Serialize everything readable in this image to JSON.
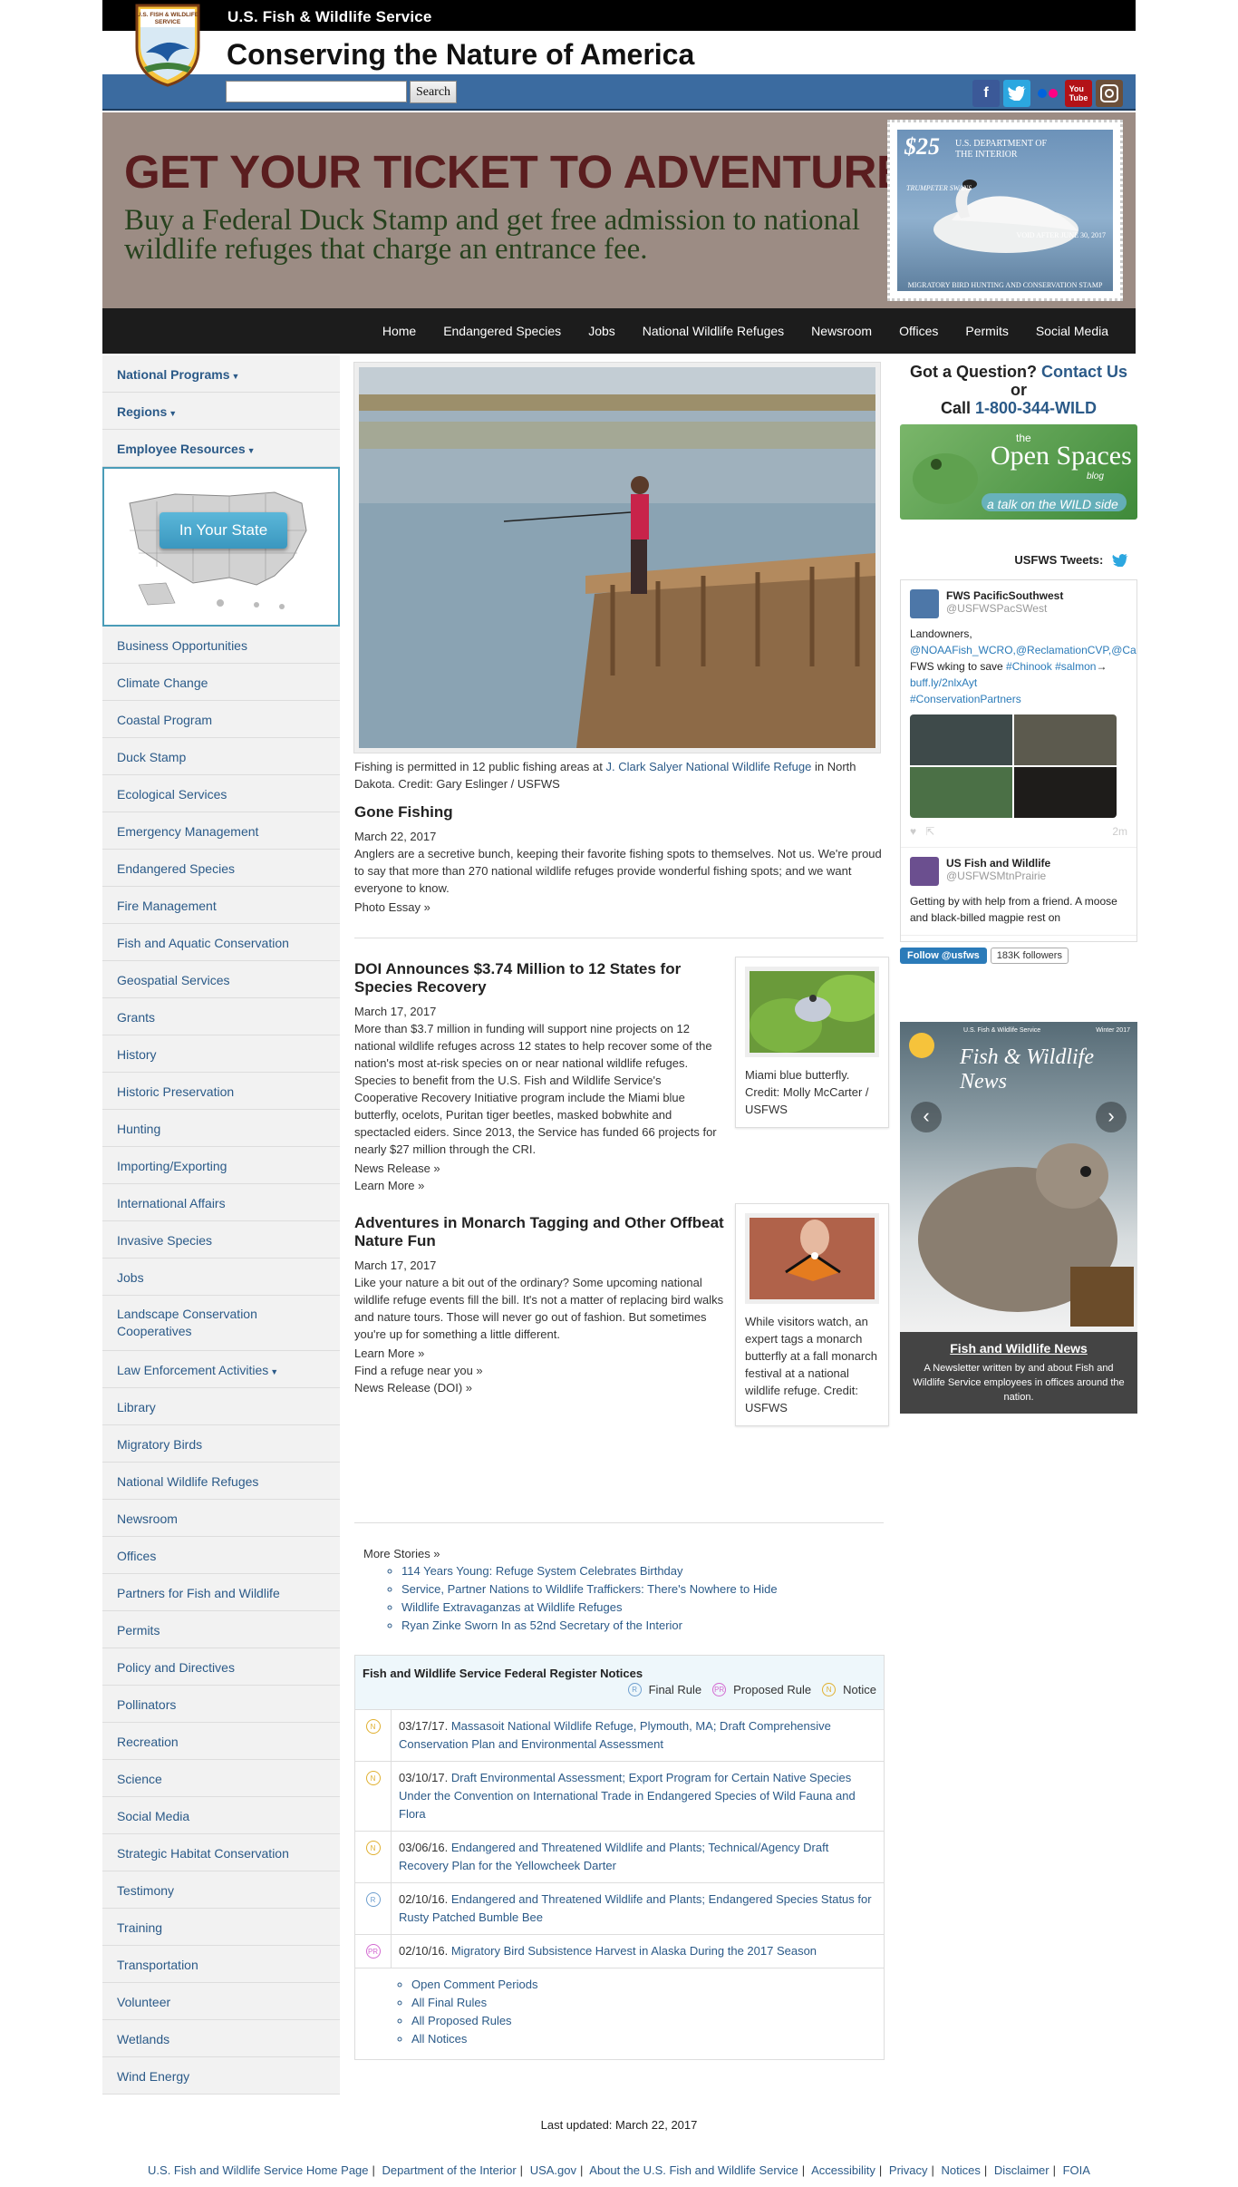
{
  "header": {
    "agency": "U.S. Fish & Wildlife Service",
    "tagline": "Conserving the Nature of America",
    "search_button": "Search",
    "search_placeholder": "",
    "logo_text": "U.S. FISH & WILDLIFE SERVICE",
    "social": [
      "facebook-icon",
      "twitter-icon",
      "flickr-icon",
      "youtube-icon",
      "instagram-icon"
    ]
  },
  "banner": {
    "title": "GET YOUR TICKET TO ADVENTURE",
    "subtitle": "Buy a Federal Duck Stamp and get free admission to national wildlife refuges that charge an entrance fee.",
    "stamp_price": "$25",
    "stamp_dept": "U.S. DEPARTMENT OF THE INTERIOR",
    "stamp_species": "TRUMPETER SWANS",
    "stamp_void": "VOID AFTER JUNE 30, 2017",
    "stamp_foot": "MIGRATORY BIRD HUNTING AND CONSERVATION STAMP"
  },
  "nav": [
    "Home",
    "Endangered Species",
    "Jobs",
    "National Wildlife Refuges",
    "Newsroom",
    "Offices",
    "Permits",
    "Social Media"
  ],
  "sidebar": {
    "top": [
      "National Programs",
      "Regions",
      "Employee Resources"
    ],
    "state_button": "In Your State",
    "items": [
      "Business Opportunities",
      "Climate Change",
      "Coastal Program",
      "Duck Stamp",
      "Ecological Services",
      "Emergency Management",
      "Endangered Species",
      "Fire Management",
      "Fish and Aquatic Conservation",
      "Geospatial Services",
      "Grants",
      "History",
      "Historic Preservation",
      "Hunting",
      "Importing/Exporting",
      "International Affairs",
      "Invasive Species",
      "Jobs",
      "Landscape Conservation Cooperatives",
      "Law Enforcement Activities",
      "Library",
      "Migratory Birds",
      "National Wildlife Refuges",
      "Newsroom",
      "Offices",
      "Partners for Fish and Wildlife",
      "Permits",
      "Policy and Directives",
      "Pollinators",
      "Recreation",
      "Science",
      "Social Media",
      "Strategic Habitat Conservation",
      "Testimony",
      "Training",
      "Transportation",
      "Volunteer",
      "Wetlands",
      "Wind Energy"
    ]
  },
  "feature": {
    "caption_pre": "Fishing is permitted in 12 public fishing areas at ",
    "caption_link": "J. Clark Salyer National Wildlife Refuge",
    "caption_post": " in North Dakota.  Credit: Gary Eslinger / USFWS",
    "title": "Gone Fishing",
    "date": "March 22, 2017",
    "body": "Anglers are a secretive bunch, keeping their favorite fishing spots to themselves. Not us. We're proud to say that more than 270 national wildlife refuges provide wonderful fishing spots; and we want everyone to know.",
    "link": "Photo Essay »"
  },
  "story1": {
    "title": "DOI Announces $3.74 Million to 12 States for Species Recovery",
    "date": "March 17, 2017",
    "body": "More than $3.7 million in funding will support nine projects on 12 national wildlife refuges across 12 states to help recover some of the nation's most at-risk species on or near national wildlife refuges. Species to benefit from the U.S. Fish and Wildlife Service's Cooperative Recovery Initiative program include the Miami blue butterfly, ocelots, Puritan tiger beetles, masked bobwhite and spectacled eiders. Since 2013, the Service has funded 66 projects for nearly $27 million through the CRI.",
    "link1": "News Release »",
    "link2": "Learn More »",
    "thumb_caption": "Miami blue butterfly. Credit: Molly McCarter / USFWS"
  },
  "story2": {
    "title": "Adventures in Monarch Tagging and Other Offbeat Nature Fun",
    "date": "March 17, 2017",
    "body": "Like your nature a bit out of the ordinary? Some upcoming national wildlife refuge events fill the bill. It's not a matter of replacing bird walks and nature tours. Those will never go out of fashion. But sometimes you're up for something a little different.",
    "link1": "Learn More »",
    "link2": "Find a refuge near you »",
    "link3": "News Release (DOI) »",
    "thumb_caption": "While visitors watch, an expert tags a monarch butterfly at a fall monarch festival at a national wildlife refuge. Credit: USFWS"
  },
  "more_stories": {
    "label": "More Stories »",
    "items": [
      "114 Years Young: Refuge System Celebrates Birthday",
      "Service, Partner Nations to Wildlife Traffickers: There's Nowhere to Hide",
      "Wildlife Extravaganzas at Wildlife Refuges",
      "Ryan Zinke Sworn In as 52nd Secretary of the Interior"
    ]
  },
  "federal_register": {
    "title": "Fish and Wildlife Service Federal Register Notices",
    "legend": {
      "final": "Final Rule",
      "proposed": "Proposed Rule",
      "notice": "Notice"
    },
    "rows": [
      {
        "type": "N",
        "date": "03/17/17. ",
        "text": "Massasoit National Wildlife Refuge, Plymouth, MA; Draft Comprehensive Conservation Plan and Environmental Assessment"
      },
      {
        "type": "N",
        "date": "03/10/17. ",
        "text": "Draft Environmental Assessment; Export Program for Certain Native Species Under the Convention on International Trade in Endangered Species of Wild Fauna and Flora"
      },
      {
        "type": "N",
        "date": "03/06/16. ",
        "text": "Endangered and Threatened Wildlife and Plants; Technical/Agency Draft Recovery Plan for the Yellowcheek Darter"
      },
      {
        "type": "R",
        "date": "02/10/16. ",
        "text": "Endangered and Threatened Wildlife and Plants; Endangered Species Status for Rusty Patched Bumble Bee"
      },
      {
        "type": "PR",
        "date": "02/10/16. ",
        "text": "Migratory Bird Subsistence Harvest in Alaska During the 2017 Season"
      }
    ],
    "links": [
      "Open Comment Periods",
      "All Final Rules",
      "All Proposed Rules",
      "All Notices"
    ]
  },
  "right": {
    "question_pre": "Got a Question? ",
    "question_link": "Contact Us",
    "question_or": " or",
    "question_call": "Call ",
    "question_phone": "1-800-344-WILD",
    "os_the": "the",
    "os_title": "Open Spaces",
    "os_blog": "blog",
    "os_talk": "a talk on the WILD side",
    "tweets_label": "USFWS Tweets:",
    "tweet1": {
      "name": "FWS PacificSouthwest",
      "handle": "@USFWSPacSWest",
      "text_pre": "Landowners, ",
      "text_mentions": "@NOAAFish_WCRO,@ReclamationCVP,@CaliforniaDFW",
      "text_mid": ", FWS wking to save ",
      "text_tags": "#Chinook #salmon",
      "text_arrow": "→ ",
      "text_url": "buff.ly/2nlxAyt",
      "text_tag2": "#ConservationPartners",
      "time": "2m"
    },
    "tweet2": {
      "name": "US Fish and Wildlife",
      "handle": "@USFWSMtnPrairie",
      "text": "Getting by with help from a friend. A moose and black-billed magpie rest on"
    },
    "follow_btn": "Follow @usfws",
    "followers": "183K followers",
    "news_top": "U.S. Fish & Wildlife Service",
    "news_date": "Winter 2017",
    "news_mast": "Fish & Wildlife News",
    "news_title": "Fish and Wildlife News",
    "news_desc": "A Newsletter written by and about Fish and Wildlife Service employees in offices around the nation."
  },
  "footer": {
    "updated": "Last updated: March 22, 2017",
    "links": [
      "U.S. Fish and Wildlife Service Home Page",
      "Department of the Interior",
      "USA.gov",
      "About the U.S. Fish and Wildlife Service",
      "Accessibility",
      "Privacy",
      "Notices",
      "Disclaimer",
      "FOIA"
    ]
  },
  "colors": {
    "link": "#2b5a88",
    "searchbar": "#3b6ba0",
    "nav": "#1c1c1c",
    "banner_title": "#5a1d1f",
    "banner_sub": "#27421e"
  }
}
